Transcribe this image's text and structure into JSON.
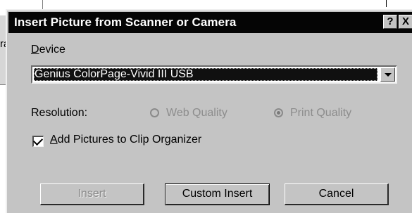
{
  "background_window": {
    "fragment_top": "ra",
    "fragment_bottom": ","
  },
  "dialog": {
    "title": "Insert Picture from Scanner or Camera",
    "help_label": "?",
    "close_label": "X"
  },
  "device": {
    "label": "Device",
    "selected": "Genius ColorPage-Vivid III USB"
  },
  "resolution": {
    "label": "Resolution:",
    "options": [
      {
        "label": "Web Quality",
        "selected": false,
        "enabled": false
      },
      {
        "label": "Print Quality",
        "selected": true,
        "enabled": false
      }
    ]
  },
  "clip_organizer": {
    "label": "Add Pictures to Clip Organizer",
    "checked": true
  },
  "buttons": {
    "insert": "Insert",
    "custom_insert": "Custom Insert",
    "cancel": "Cancel"
  },
  "colors": {
    "dialog_bg": "#c4c4c4",
    "titlebar_bg": "#050505",
    "selection_bg": "#101010",
    "disabled_text": "#8c8c8c"
  },
  "icons": {
    "help": "help-icon",
    "close": "close-icon",
    "dropdown": "chevron-down-icon"
  }
}
